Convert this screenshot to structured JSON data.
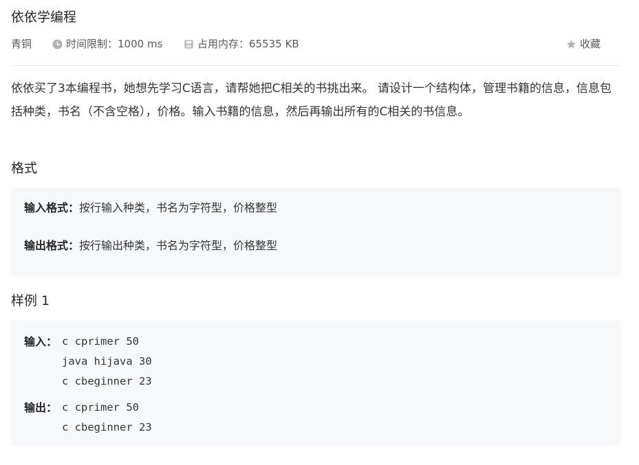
{
  "problem": {
    "title": "依依学编程",
    "level": "青铜",
    "time_limit": "时间限制：1000 ms",
    "memory_limit": "占用内存：65535 KB",
    "favorite_label": "收藏",
    "description": "依依买了3本编程书，她想先学习C语言，请帮她把C相关的书挑出来。 请设计一个结构体，管理书籍的信息，信息包括种类，书名（不含空格），价格。输入书籍的信息，然后再输出所有的C相关的书信息。"
  },
  "format": {
    "heading": "格式",
    "input_label": "输入格式：",
    "input_text": "按行输入种类，书名为字符型，价格整型",
    "output_label": "输出格式：",
    "output_text": "按行输出种类，书名为字符型，价格整型"
  },
  "sample": {
    "heading": "样例 1",
    "input_label": "输入：",
    "input_lines": [
      "c cprimer 50",
      "java hijava 30",
      "c cbeginner 23"
    ],
    "output_label": "输出：",
    "output_lines": [
      "c cprimer 50",
      "c cbeginner 23"
    ]
  },
  "icons": {
    "time": "clock-icon",
    "memory": "memory-icon",
    "favorite": "star-icon"
  },
  "colors": {
    "text": "#333333",
    "muted": "#595959",
    "icon": "#b3b3b3",
    "box_bg": "#f7f8fa",
    "divider": "#e5e5e5"
  }
}
